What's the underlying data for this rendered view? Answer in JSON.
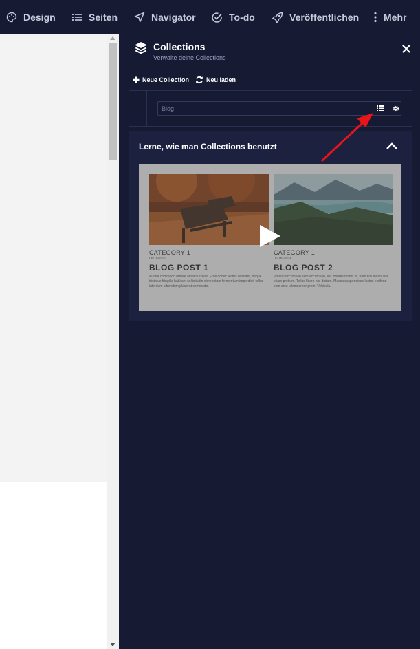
{
  "topbar": {
    "items": [
      {
        "label": "Design",
        "icon": "palette-icon"
      },
      {
        "label": "Seiten",
        "icon": "list-icon"
      },
      {
        "label": "Navigator",
        "icon": "navigation-arrow-icon"
      },
      {
        "label": "To-do",
        "icon": "check-circle-icon"
      },
      {
        "label": "Veröffentlichen",
        "icon": "rocket-icon"
      },
      {
        "label": "Mehr",
        "icon": "more-vertical-icon"
      }
    ]
  },
  "panel": {
    "title": "Collections",
    "subtitle": "Verwalte deine Collections",
    "new_collection_label": "Neue Collection",
    "reload_label": "Neu laden",
    "collection_name": "Blog",
    "learn_title": "Lerne, wie man Collections benutzt"
  },
  "video": {
    "posts": [
      {
        "category": "CATEGORY 1",
        "date": "06/18/2019",
        "title": "BLOG POST 1",
        "text": "Auctor commodo ornare amet quisque. Eros donec lectus habitant, neque tristique fringilla habitant sollicitudin elementum fermentum imperdiet, tellus interdum bibendum placerat commodo."
      },
      {
        "category": "CATEGORY 1",
        "date": "06/18/2019",
        "title": "BLOG POST 2",
        "text": "Potenti accumsan sem accumsan, est lobortis mattis id, nam nisi mattis hac etiam pretium. Tellus libero nisi dictum. Massa suspendisse luctus eleifend sem arcu ullamcorper proin! Vehicula."
      }
    ]
  },
  "colors": {
    "background": "#161a33",
    "panel_card": "#1c2140",
    "arrow": "#e8141a",
    "text": "#ffffff"
  }
}
